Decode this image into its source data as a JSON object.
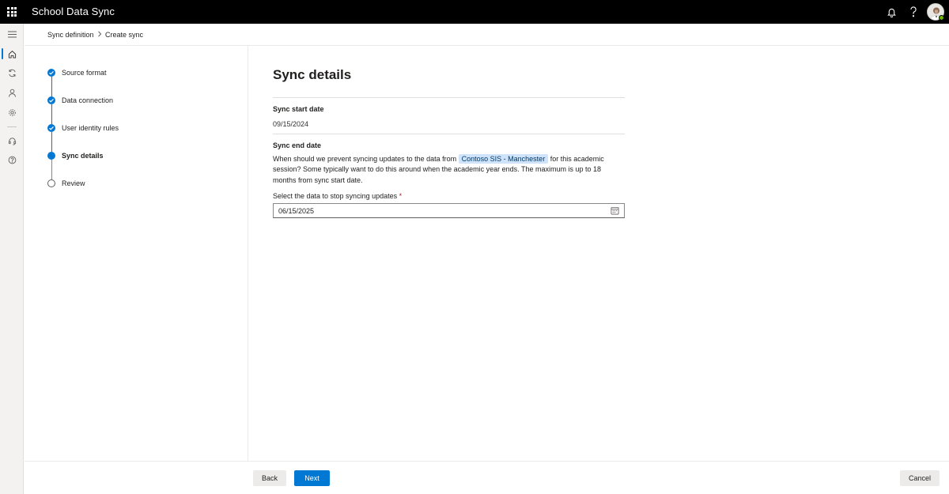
{
  "app": {
    "title": "School Data Sync",
    "icons": {
      "waffle": "app-launcher-icon",
      "notifications": "bell-icon",
      "help": "help-icon",
      "avatar": "user-avatar"
    }
  },
  "rail": {
    "items": [
      {
        "icon": "hamburger-menu-icon"
      },
      {
        "icon": "home-icon",
        "active": true
      },
      {
        "icon": "sync-icon"
      },
      {
        "icon": "person-icon"
      },
      {
        "icon": "settings-gear-icon"
      },
      {
        "icon": "headset-icon"
      },
      {
        "icon": "question-icon"
      }
    ]
  },
  "breadcrumb": {
    "items": [
      "Sync definition",
      "Create sync"
    ]
  },
  "steps": [
    {
      "label": "Source format",
      "state": "done"
    },
    {
      "label": "Data connection",
      "state": "done"
    },
    {
      "label": "User identity rules",
      "state": "done"
    },
    {
      "label": "Sync details",
      "state": "current"
    },
    {
      "label": "Review",
      "state": "todo"
    }
  ],
  "main": {
    "title": "Sync details",
    "start_date": {
      "label": "Sync start date",
      "value": "09/15/2024"
    },
    "end_date": {
      "label": "Sync end date",
      "desc_before": "When should we prevent syncing updates to the data from ",
      "source_tag": "Contoso SIS - Manchester",
      "desc_after": " for this academic session? Some typically want to do this around when the academic year ends. The maximum is up to 18 months from sync start date.",
      "field_label": "Select the data to stop syncing updates",
      "required_marker": "*",
      "value": "06/15/2025",
      "calendar_icon": "calendar-icon"
    }
  },
  "footer": {
    "back_label": "Back",
    "next_label": "Next",
    "cancel_label": "Cancel"
  },
  "colors": {
    "accent": "#0078d4",
    "topbar": "#000000",
    "tag_bg": "#cfe4fa",
    "required": "#a4262c",
    "presence": "#6bb700"
  }
}
